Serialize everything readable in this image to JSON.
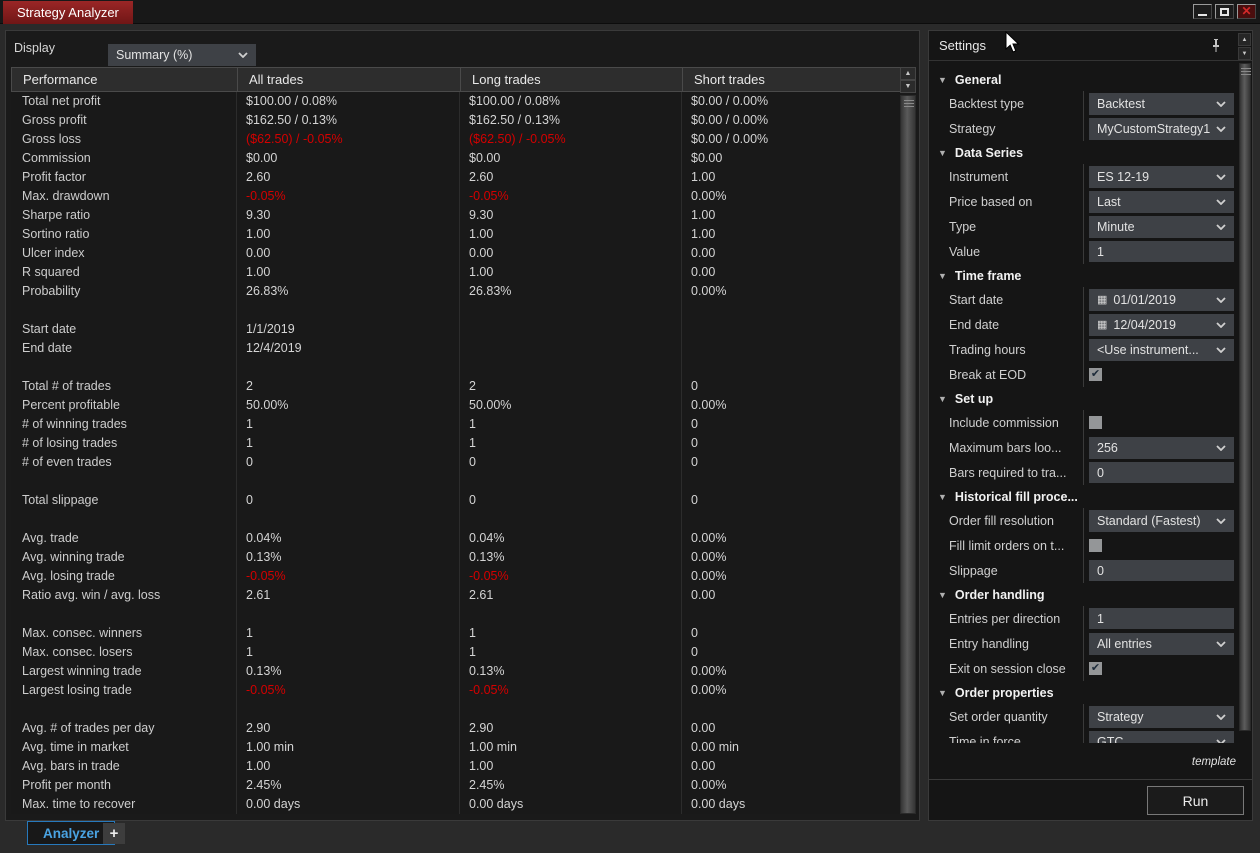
{
  "window": {
    "title": "Strategy Analyzer"
  },
  "toolbar": {
    "display_label": "Display",
    "display_value": "Summary (%)"
  },
  "table": {
    "headers": [
      "Performance",
      "All trades",
      "Long trades",
      "Short trades"
    ],
    "negative_color": "#d40000",
    "rows": [
      {
        "label": "Total net profit",
        "cells": [
          "$100.00 / 0.08%",
          "$100.00 / 0.08%",
          "$0.00 / 0.00%"
        ],
        "neg": []
      },
      {
        "label": "Gross profit",
        "cells": [
          "$162.50 / 0.13%",
          "$162.50 / 0.13%",
          "$0.00 / 0.00%"
        ],
        "neg": []
      },
      {
        "label": "Gross loss",
        "cells": [
          "($62.50) / -0.05%",
          "($62.50) / -0.05%",
          "$0.00 / 0.00%"
        ],
        "neg": [
          0,
          1
        ]
      },
      {
        "label": "Commission",
        "cells": [
          "$0.00",
          "$0.00",
          "$0.00"
        ],
        "neg": []
      },
      {
        "label": "Profit factor",
        "cells": [
          "2.60",
          "2.60",
          "1.00"
        ],
        "neg": []
      },
      {
        "label": "Max. drawdown",
        "cells": [
          "-0.05%",
          "-0.05%",
          "0.00%"
        ],
        "neg": [
          0,
          1
        ]
      },
      {
        "label": "Sharpe ratio",
        "cells": [
          "9.30",
          "9.30",
          "1.00"
        ],
        "neg": []
      },
      {
        "label": "Sortino ratio",
        "cells": [
          "1.00",
          "1.00",
          "1.00"
        ],
        "neg": []
      },
      {
        "label": "Ulcer index",
        "cells": [
          "0.00",
          "0.00",
          "0.00"
        ],
        "neg": []
      },
      {
        "label": "R squared",
        "cells": [
          "1.00",
          "1.00",
          "0.00"
        ],
        "neg": []
      },
      {
        "label": "Probability",
        "cells": [
          "26.83%",
          "26.83%",
          "0.00%"
        ],
        "neg": []
      },
      {
        "spacer": true
      },
      {
        "label": "Start date",
        "cells": [
          "1/1/2019",
          "",
          ""
        ],
        "neg": []
      },
      {
        "label": "End date",
        "cells": [
          "12/4/2019",
          "",
          ""
        ],
        "neg": []
      },
      {
        "spacer": true
      },
      {
        "label": "Total # of trades",
        "cells": [
          "2",
          "2",
          "0"
        ],
        "neg": []
      },
      {
        "label": "Percent profitable",
        "cells": [
          "50.00%",
          "50.00%",
          "0.00%"
        ],
        "neg": []
      },
      {
        "label": "# of winning trades",
        "cells": [
          "1",
          "1",
          "0"
        ],
        "neg": []
      },
      {
        "label": "# of losing trades",
        "cells": [
          "1",
          "1",
          "0"
        ],
        "neg": []
      },
      {
        "label": "# of even trades",
        "cells": [
          "0",
          "0",
          "0"
        ],
        "neg": []
      },
      {
        "spacer": true
      },
      {
        "label": "Total slippage",
        "cells": [
          "0",
          "0",
          "0"
        ],
        "neg": []
      },
      {
        "spacer": true
      },
      {
        "label": "Avg. trade",
        "cells": [
          "0.04%",
          "0.04%",
          "0.00%"
        ],
        "neg": []
      },
      {
        "label": "Avg. winning trade",
        "cells": [
          "0.13%",
          "0.13%",
          "0.00%"
        ],
        "neg": []
      },
      {
        "label": "Avg. losing trade",
        "cells": [
          "-0.05%",
          "-0.05%",
          "0.00%"
        ],
        "neg": [
          0,
          1
        ]
      },
      {
        "label": "Ratio avg. win / avg. loss",
        "cells": [
          "2.61",
          "2.61",
          "0.00"
        ],
        "neg": []
      },
      {
        "spacer": true
      },
      {
        "label": "Max. consec. winners",
        "cells": [
          "1",
          "1",
          "0"
        ],
        "neg": []
      },
      {
        "label": "Max. consec. losers",
        "cells": [
          "1",
          "1",
          "0"
        ],
        "neg": []
      },
      {
        "label": "Largest winning trade",
        "cells": [
          "0.13%",
          "0.13%",
          "0.00%"
        ],
        "neg": []
      },
      {
        "label": "Largest losing trade",
        "cells": [
          "-0.05%",
          "-0.05%",
          "0.00%"
        ],
        "neg": [
          0,
          1
        ]
      },
      {
        "spacer": true
      },
      {
        "label": "Avg. # of trades per day",
        "cells": [
          "2.90",
          "2.90",
          "0.00"
        ],
        "neg": []
      },
      {
        "label": "Avg. time in market",
        "cells": [
          "1.00 min",
          "1.00 min",
          "0.00 min"
        ],
        "neg": []
      },
      {
        "label": "Avg. bars in trade",
        "cells": [
          "1.00",
          "1.00",
          "0.00"
        ],
        "neg": []
      },
      {
        "label": "Profit per month",
        "cells": [
          "2.45%",
          "2.45%",
          "0.00%"
        ],
        "neg": []
      },
      {
        "label": "Max. time to recover",
        "cells": [
          "0.00 days",
          "0.00 days",
          "0.00 days"
        ],
        "neg": []
      }
    ]
  },
  "settings": {
    "title": "Settings",
    "sections": [
      {
        "label": "General",
        "items": [
          {
            "label": "Backtest type",
            "type": "dropdown",
            "value": "Backtest"
          },
          {
            "label": "Strategy",
            "type": "dropdown",
            "value": "MyCustomStrategy1"
          }
        ]
      },
      {
        "label": "Data Series",
        "items": [
          {
            "label": "Instrument",
            "type": "dropdown",
            "value": "ES 12-19"
          },
          {
            "label": "Price based on",
            "type": "dropdown",
            "value": "Last"
          },
          {
            "label": "Type",
            "type": "dropdown",
            "value": "Minute"
          },
          {
            "label": "Value",
            "type": "input",
            "value": "1"
          }
        ]
      },
      {
        "label": "Time frame",
        "items": [
          {
            "label": "Start date",
            "type": "dropdown",
            "value": "01/01/2019",
            "icon": "calendar"
          },
          {
            "label": "End date",
            "type": "dropdown",
            "value": "12/04/2019",
            "icon": "calendar"
          },
          {
            "label": "Trading hours",
            "type": "dropdown",
            "value": "<Use instrument..."
          },
          {
            "label": "Break at EOD",
            "type": "checkbox",
            "checked": true
          }
        ]
      },
      {
        "label": "Set up",
        "items": [
          {
            "label": "Include commission",
            "type": "checkbox",
            "checked": false
          },
          {
            "label": "Maximum bars loo...",
            "type": "dropdown",
            "value": "256"
          },
          {
            "label": "Bars required to tra...",
            "type": "input",
            "value": "0"
          }
        ]
      },
      {
        "label": "Historical fill proce...",
        "items": [
          {
            "label": "Order fill resolution",
            "type": "dropdown",
            "value": "Standard (Fastest)"
          },
          {
            "label": "Fill limit orders on t...",
            "type": "checkbox",
            "checked": false
          },
          {
            "label": "Slippage",
            "type": "input",
            "value": "0"
          }
        ]
      },
      {
        "label": "Order handling",
        "items": [
          {
            "label": "Entries per direction",
            "type": "input",
            "value": "1"
          },
          {
            "label": "Entry handling",
            "type": "dropdown",
            "value": "All entries"
          },
          {
            "label": "Exit on session close",
            "type": "checkbox",
            "checked": true
          }
        ]
      },
      {
        "label": "Order properties",
        "items": [
          {
            "label": "Set order quantity",
            "type": "dropdown",
            "value": "Strategy"
          },
          {
            "label": "Time in force",
            "type": "dropdown",
            "value": "GTC"
          }
        ]
      }
    ],
    "template_link": "template",
    "run_button": "Run"
  },
  "tabs": {
    "analyzer": "Analyzer",
    "add": "+"
  }
}
